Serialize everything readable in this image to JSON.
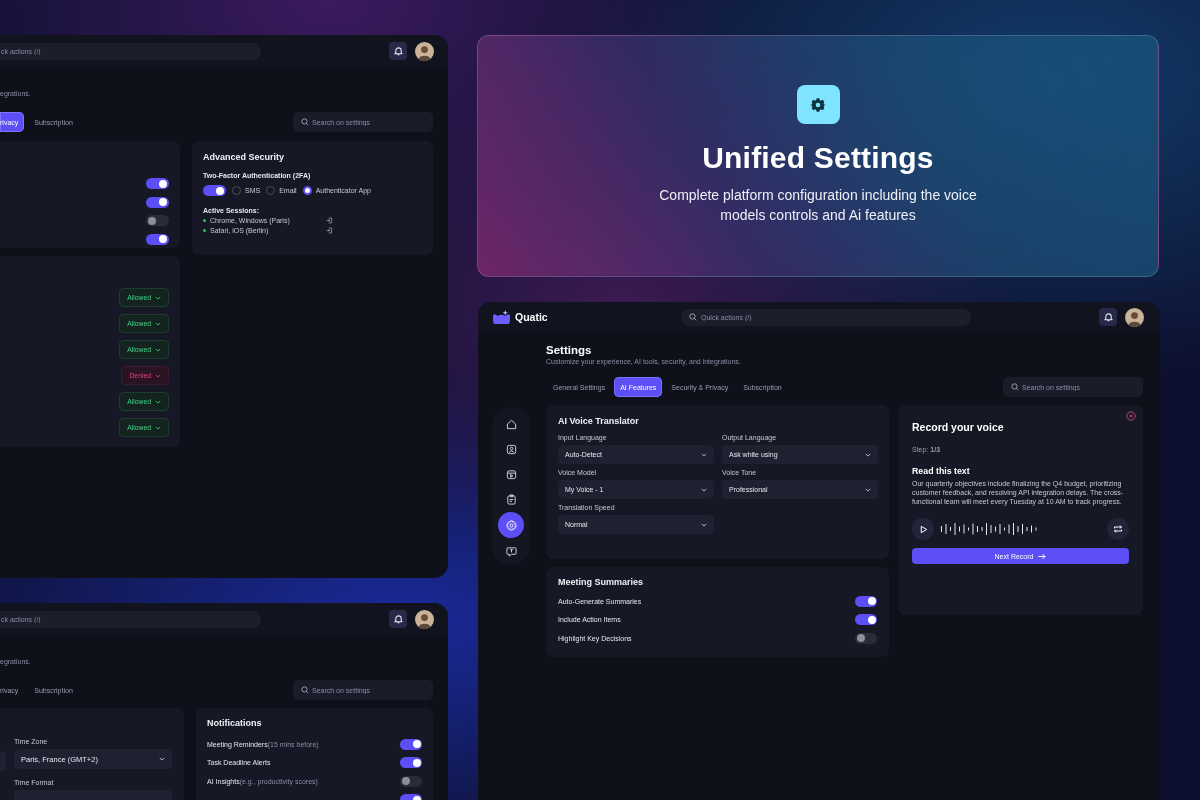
{
  "hero": {
    "title": "Unified Settings",
    "subtitle": "Complete platform configuration including the voice models controls and Ai features"
  },
  "security_window": {
    "quick_search": {
      "placeholder": "ck actions (/)"
    },
    "subtitle": "egrations.",
    "tabs": [
      {
        "label": "rivacy",
        "selected": true
      },
      {
        "label": "Subscription",
        "selected": false
      }
    ],
    "settings_search": {
      "placeholder": "Search on settings"
    },
    "toggles": [
      {
        "on": true
      },
      {
        "on": true
      },
      {
        "on": false
      },
      {
        "on": true
      }
    ],
    "advanced_security": {
      "title": "Advanced Security",
      "two_factor_label": "Two-Factor Authentication (2FA)",
      "two_factor_on": true,
      "options": [
        {
          "label": "SMS",
          "selected": false
        },
        {
          "label": "Email",
          "selected": false
        },
        {
          "label": "Authenticator App",
          "selected": true
        }
      ],
      "sessions_title": "Active Sessions:",
      "sessions": [
        "Chrome, Windows (Paris)",
        "Safari, iOS (Berlin)"
      ]
    },
    "permissions": [
      {
        "label": "Allowed",
        "kind": "allowed"
      },
      {
        "label": "Allowed",
        "kind": "allowed"
      },
      {
        "label": "Allowed",
        "kind": "allowed"
      },
      {
        "label": "Denied",
        "kind": "denied"
      },
      {
        "label": "Allowed",
        "kind": "allowed"
      },
      {
        "label": "Allowed",
        "kind": "allowed"
      }
    ]
  },
  "general_window": {
    "quick_search": {
      "placeholder": "ck actions (/)"
    },
    "subtitle": "egrations.",
    "tabs": [
      {
        "label": "rivacy",
        "selected": false
      },
      {
        "label": "Subscription",
        "selected": false
      }
    ],
    "settings_search": {
      "placeholder": "Search on settings"
    },
    "time_zone": {
      "label": "Time Zone",
      "value": "Paris, France (GMT+2)"
    },
    "time_format": {
      "label": "Time Format"
    },
    "notifications": {
      "title": "Notifications",
      "items": [
        {
          "label": "Meeting Reminders",
          "note": "(15 mins before)",
          "on": true
        },
        {
          "label": "Task Deadline Alerts",
          "on": true
        },
        {
          "label": "AI Insights",
          "note": "(e.g., productivity scores)",
          "on": false
        },
        {
          "on": true
        }
      ]
    }
  },
  "ai_window": {
    "brand": "Quatic",
    "quick_search": {
      "placeholder": "Quick actions (/)"
    },
    "nav": [
      {
        "kind": "home",
        "selected": false
      },
      {
        "kind": "portrait",
        "selected": false
      },
      {
        "kind": "media",
        "selected": false
      },
      {
        "kind": "clipboard",
        "selected": false
      },
      {
        "kind": "settings",
        "selected": true
      },
      {
        "kind": "chat",
        "selected": false
      }
    ],
    "title": "Settings",
    "subtitle": "Customize your experience, AI tools, security, and integrations.",
    "tabs": [
      {
        "label": "General Settings",
        "selected": false
      },
      {
        "label": "AI Features",
        "selected": true
      },
      {
        "label": "Security & Privacy",
        "selected": false
      },
      {
        "label": "Subscription",
        "selected": false
      }
    ],
    "settings_search": {
      "placeholder": "Search on settings"
    },
    "translator": {
      "title": "AI Voice Translator",
      "fields": [
        {
          "label": "Input Language",
          "value": "Auto-Detect"
        },
        {
          "label": "Output Language",
          "value": "Ask white using"
        },
        {
          "label": "Voice Model",
          "value": "My Voice - 1"
        },
        {
          "label": "Voice Tone",
          "value": "Professional"
        },
        {
          "label": "Translation Speed",
          "value": "Normal"
        }
      ]
    },
    "summaries": {
      "title": "Meeting Summaries",
      "items": [
        {
          "label": "Auto-Generate Summaries",
          "on": true
        },
        {
          "label": "Include Action Items",
          "on": true
        },
        {
          "label": "Highlight Key Decisions",
          "on": false
        }
      ]
    },
    "record": {
      "title": "Record your voice",
      "step": "Step: **1/3**",
      "read_title": "Read this text",
      "text": "Our quarterly objectives include finalizing the Q4 budget, prioritizing customer feedback, and resolving API integration delays. The cross-functional team will meet every Tuesday at 10 AM to track progress.",
      "button": "Next Record"
    }
  }
}
